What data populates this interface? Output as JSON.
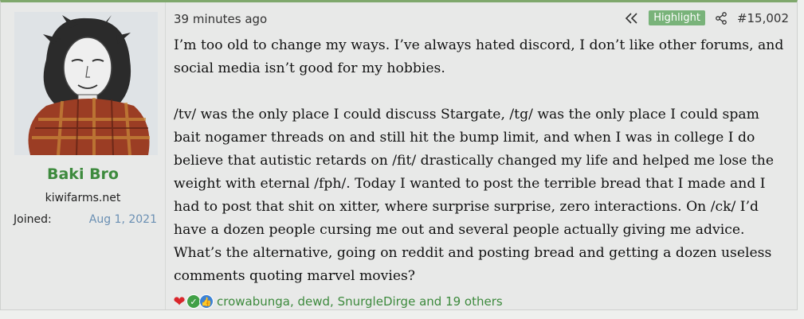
{
  "user": {
    "name": "Baki Bro",
    "title": "kiwifarms.net",
    "joined_label": "Joined:",
    "joined_value": "Aug 1, 2021"
  },
  "post": {
    "time": "39 minutes ago",
    "highlight_label": "Highlight",
    "number": "#15,002",
    "paragraphs": [
      "I’m too old to change my ways. I’ve always hated discord, I don’t like other forums, and social media isn’t good for my hobbies.",
      "/tv/ was the only place I could discuss Stargate, /tg/ was the only place I could spam bait nogamer threads on and still hit the bump limit, and when I was in college I do believe that autistic retards on /fit/ drastically changed my life and helped me lose the weight with eternal /fph/. Today I wanted to post the terrible bread that I made and I had to post that shit on xitter, where surprise surprise, zero interactions. On /ck/ I’d have a dozen people cursing me out and several people actually giving me advice. What’s the alternative, going on reddit and posting bread and getting a dozen useless comments quoting marvel movies?"
    ],
    "reactions_text": "crowabunga, dewd, SnurgleDirge and 19 others",
    "reaction_icons": [
      "heart-icon",
      "check-icon",
      "thumbs-up-icon"
    ]
  },
  "colors": {
    "accent_green": "#3d8a3d",
    "highlight_bg": "#79b37a",
    "joined_blue": "#6a8fb3"
  }
}
